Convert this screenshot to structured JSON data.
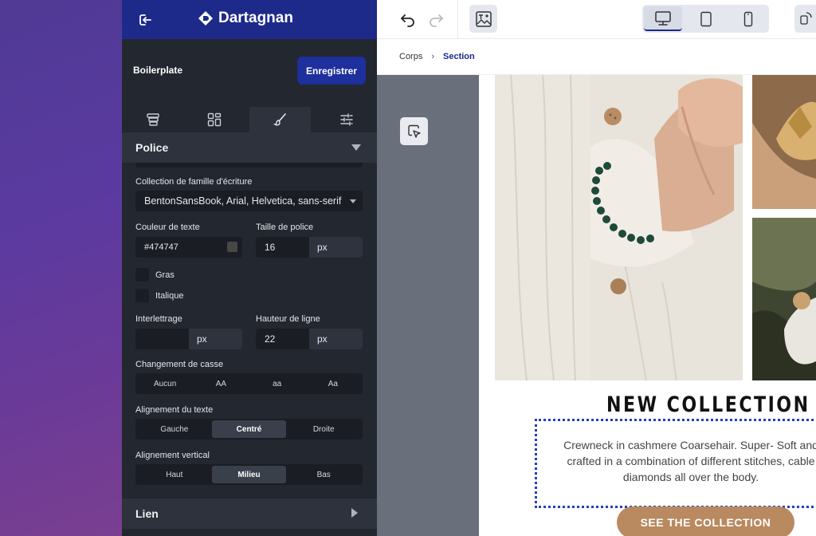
{
  "app": {
    "brand": "Dartagnan",
    "document_name": "Boilerplate",
    "save_label": "Enregistrer"
  },
  "sidebar": {
    "tabs": [
      {
        "icon": "layers-icon"
      },
      {
        "icon": "blocks-icon"
      },
      {
        "icon": "brush-icon",
        "active": true
      },
      {
        "icon": "sliders-icon"
      }
    ],
    "section_font": "Police",
    "font_family_label": "Collection de famille d'écriture",
    "font_family_value": "BentonSansBook, Arial, Helvetica, sans-serif",
    "text_color_label": "Couleur de texte",
    "text_color_value": "#474747",
    "font_size_label": "Taille de police",
    "font_size_value": "16",
    "font_size_unit": "px",
    "bold_label": "Gras",
    "italic_label": "Italique",
    "letter_spacing_label": "Interlettrage",
    "letter_spacing_value": "",
    "letter_spacing_unit": "px",
    "line_height_label": "Hauteur de ligne",
    "line_height_value": "22",
    "line_height_unit": "px",
    "case_label": "Changement de casse",
    "case_options": [
      "Aucun",
      "AA",
      "aa",
      "Aa"
    ],
    "align_label": "Alignement du texte",
    "align_options": [
      "Gauche",
      "Centré",
      "Droite"
    ],
    "align_selected": "Centré",
    "valign_label": "Alignement vertical",
    "valign_options": [
      "Haut",
      "Milieu",
      "Bas"
    ],
    "valign_selected": "Milieu",
    "section_link": "Lien"
  },
  "breadcrumb": [
    "Corps",
    "Section"
  ],
  "toolbar": {
    "devices": [
      "desktop-icon",
      "tablet-icon",
      "mobile-icon"
    ],
    "active_device": "desktop-icon"
  },
  "preview": {
    "title": "NEW COLLECTION",
    "description": "Crewneck in cashmere Coarsehair. Super- Soft and crafted in a combination of different stitches, cable diamonds all over the body.",
    "cta": "SEE THE COLLECTION"
  },
  "colors": {
    "brand_bar": "#1d2a8a",
    "save_button": "#1e2f9e",
    "panel_bg": "#23272f",
    "cta": "#b9895f",
    "selection_outline": "#2540b8"
  }
}
